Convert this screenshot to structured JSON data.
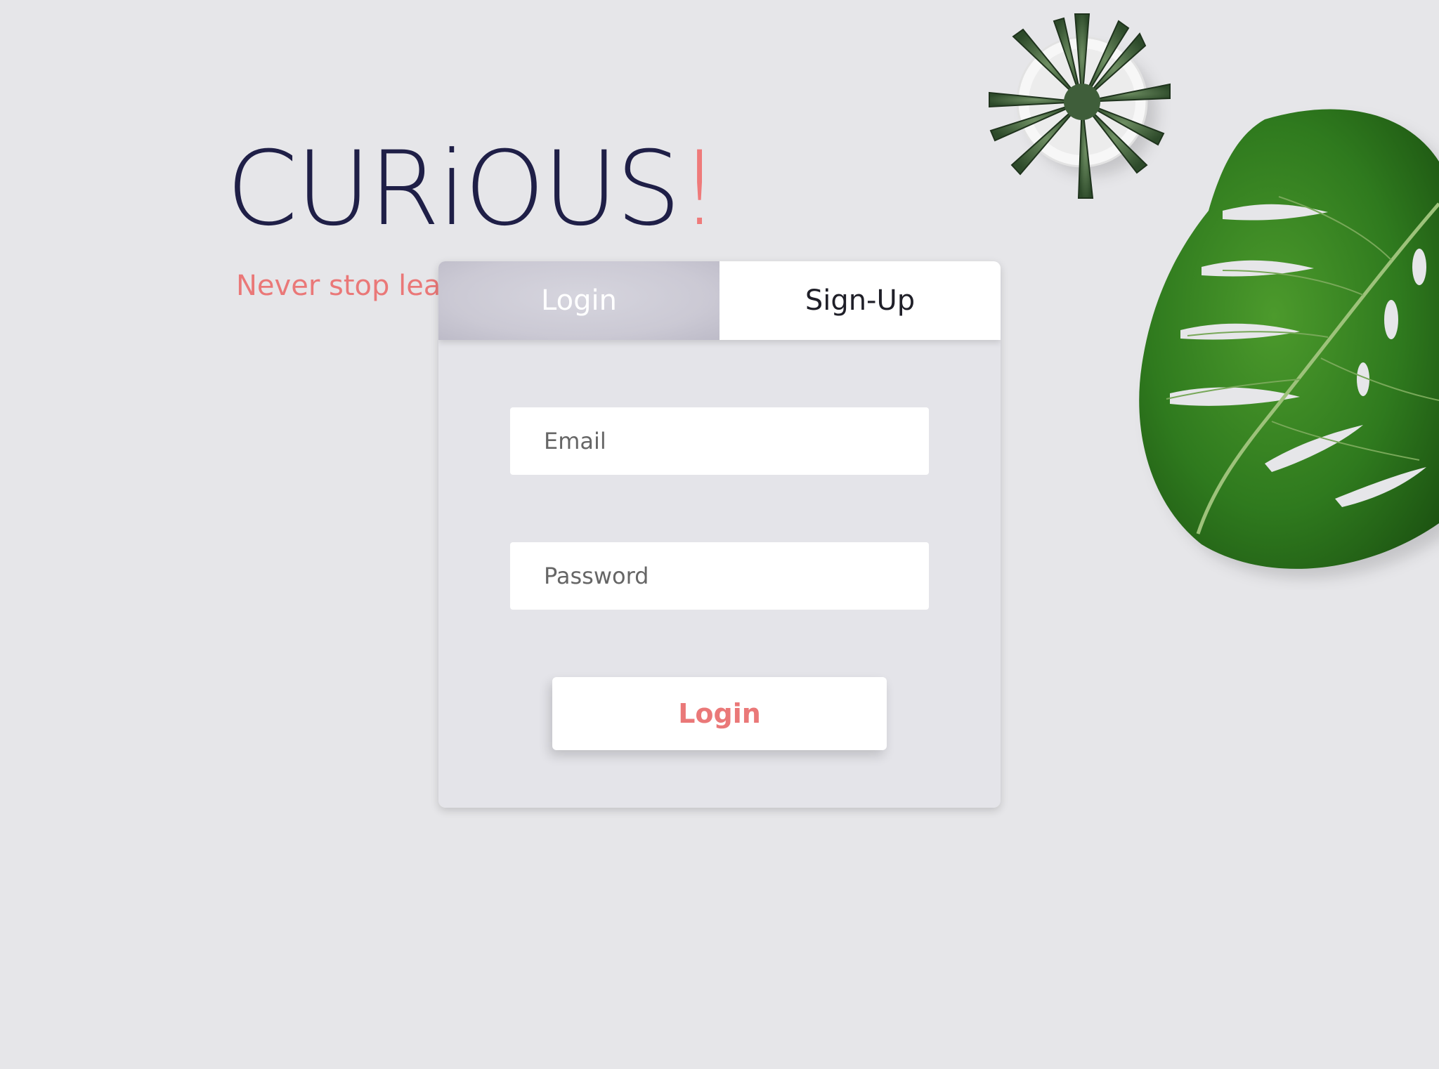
{
  "brand": {
    "name": "CURiOUS",
    "bang": "!",
    "tagline": "Never stop learning"
  },
  "tabs": [
    {
      "label": "Login",
      "active": true
    },
    {
      "label": "Sign-Up",
      "active": false
    }
  ],
  "form": {
    "email_placeholder": "Email",
    "password_placeholder": "Password",
    "submit_label": "Login"
  },
  "colors": {
    "background": "#e6e6e9",
    "brand_text": "#1f1f47",
    "accent": "#ea7878",
    "leaf": "#2f7a1e"
  },
  "decor": {
    "icons": [
      "succulent-pot-icon",
      "monstera-leaf-icon"
    ]
  }
}
